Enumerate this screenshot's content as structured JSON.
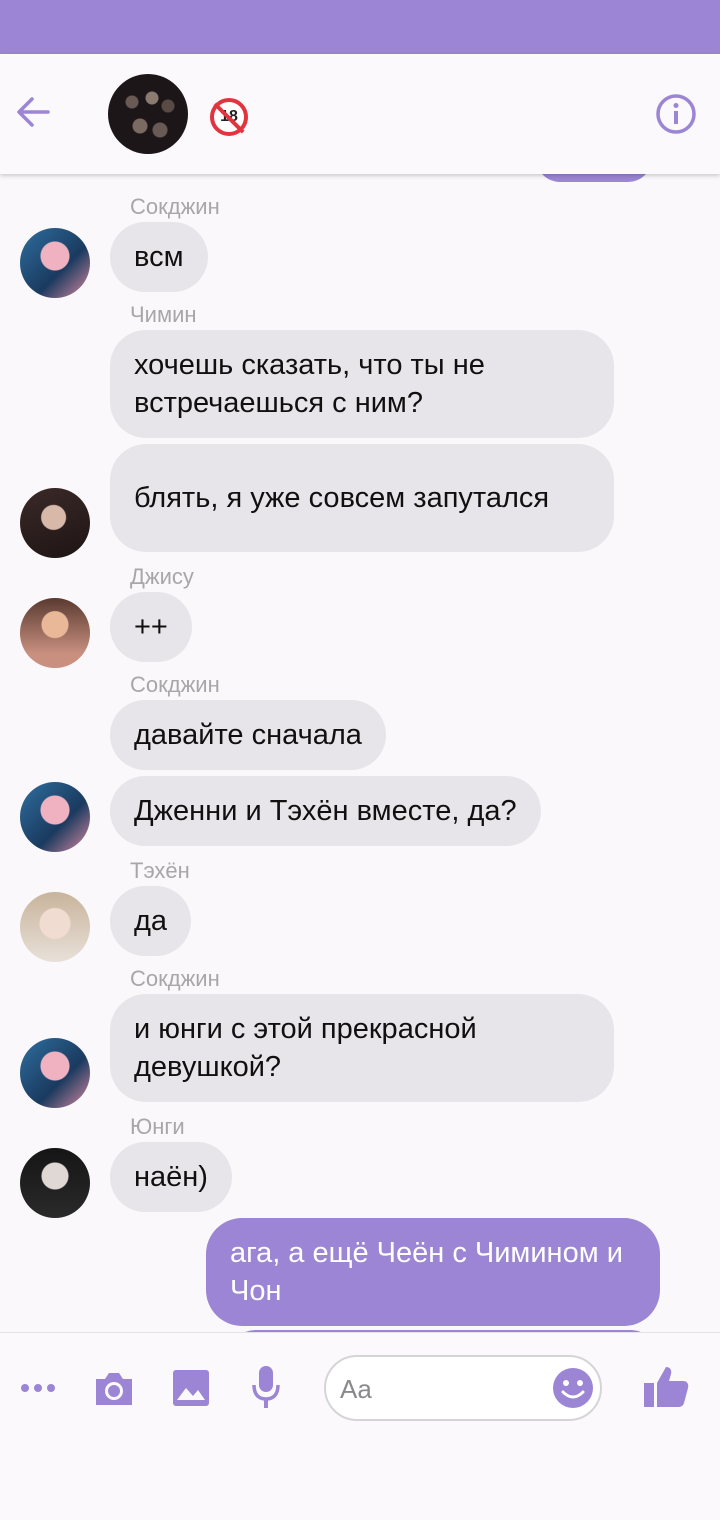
{
  "app": {
    "accent": "#9b85d4",
    "incoming_bubble": "#e7e5e9"
  },
  "header": {
    "back_icon": "arrow-left-icon",
    "group_avatar": "group-photo",
    "badge": "18",
    "info_icon": "info-icon"
  },
  "messages": [
    {
      "sender": "Сокджин",
      "text": "всм"
    },
    {
      "sender": "Чимин",
      "text": "хочешь сказать, что ты не встречаешься с ним?"
    },
    {
      "sender": "",
      "text": "блять, я уже совсем запутался"
    },
    {
      "sender": "Джису",
      "text": "++"
    },
    {
      "sender": "Сокджин",
      "text": "давайте сначала"
    },
    {
      "sender": "",
      "text": "Дженни и Тэхён вместе, да?"
    },
    {
      "sender": "Тэхён",
      "text": "да"
    },
    {
      "sender": "Сокджин",
      "text": "и юнги с этой прекрасной девушкой?"
    },
    {
      "sender": "Юнги",
      "text": "наён)"
    },
    {
      "sender": "",
      "text": "ага, а ещё Чеён с Чимином и Чон",
      "outgoing": true
    }
  ],
  "composer": {
    "placeholder": "Aa",
    "icons": [
      "more-icon",
      "camera-icon",
      "image-icon",
      "microphone-icon",
      "emoji-icon",
      "thumbs-up-icon"
    ]
  }
}
